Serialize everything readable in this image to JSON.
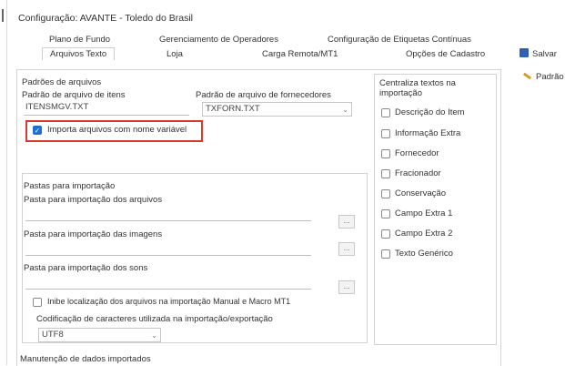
{
  "window": {
    "title": "Configuração: AVANTE - Toledo do Brasil"
  },
  "tabs": {
    "row1": [
      "Plano de Fundo",
      "Gerenciamento de Operadores",
      "Configuração de Etiquetas Contínuas"
    ],
    "row2": [
      "Arquivos Texto",
      "Loja",
      "Carga Remota/MT1",
      "Opções de Cadastro"
    ],
    "active": "Arquivos Texto"
  },
  "toolbar": {
    "save_label": "Salvar",
    "defaults_label": "Padrão"
  },
  "padroes": {
    "group_label": "Padrões de arquivos",
    "itens_label": "Padrão de arquivo de itens",
    "itens_value": "ITENSMGV.TXT",
    "fornecedores_label": "Padrão de arquivo de fornecedores",
    "fornecedores_value": "TXFORN.TXT",
    "variable_name_label": "Importa arquivos com nome variável"
  },
  "pastas": {
    "group_label": "Pastas para importação",
    "arquivos_label": "Pasta para importação dos arquivos",
    "imagens_label": "Pasta para importação das imagens",
    "sons_label": "Pasta para importação dos sons",
    "browse_label": "...",
    "inibe_label": "Inibe localização dos arquivos na importação Manual e Macro MT1",
    "codificacao_label": "Codificação de caracteres utilizada na importação/exportação",
    "codificacao_value": "UTF8"
  },
  "centraliza": {
    "group_label": "Centraliza textos na importação",
    "items": [
      "Descrição do Item",
      "Informação Extra",
      "Fornecedor",
      "Fracionador",
      "Conservação",
      "Campo Extra 1",
      "Campo Extra 2",
      "Texto Genérico"
    ]
  },
  "manutencao": {
    "label": "Manutenção de dados importados"
  }
}
